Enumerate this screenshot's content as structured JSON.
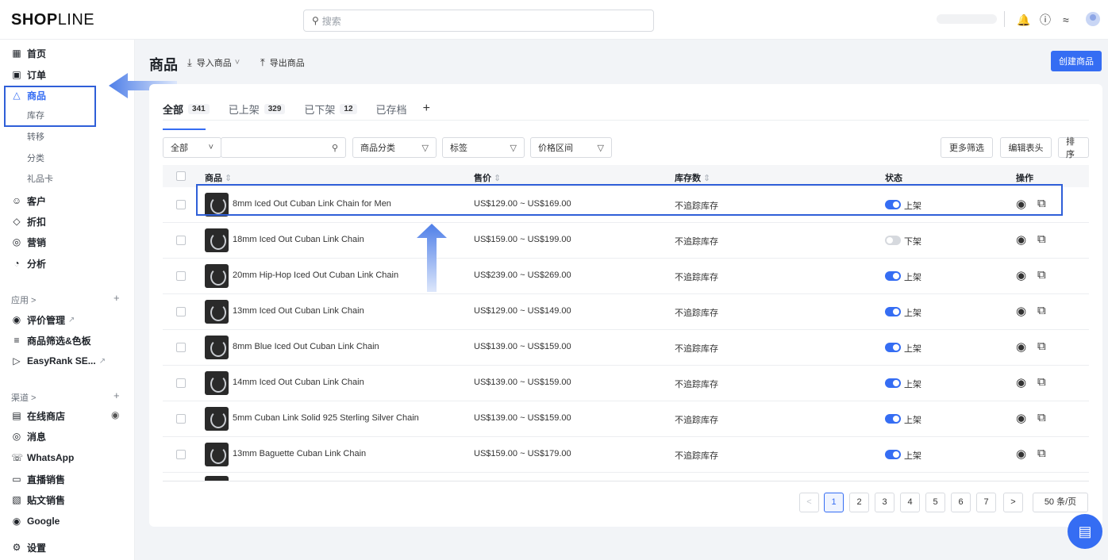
{
  "header": {
    "logo_bold": "SHOP",
    "logo_thin": "LINE",
    "search_placeholder": "搜索",
    "icons": [
      "bell-icon",
      "help-icon",
      "wifi-icon",
      "avatar"
    ]
  },
  "sidebar": {
    "items": [
      {
        "label": "首页",
        "icon": "dashboard-icon"
      },
      {
        "label": "订单",
        "icon": "order-icon"
      },
      {
        "label": "商品",
        "icon": "bag-icon",
        "active": true
      },
      {
        "label": "库存"
      },
      {
        "label": "转移"
      },
      {
        "label": "分类"
      },
      {
        "label": "礼品卡"
      },
      {
        "label": "客户",
        "icon": "user-icon"
      },
      {
        "label": "折扣",
        "icon": "tag-icon"
      },
      {
        "label": "营销",
        "icon": "target-icon"
      },
      {
        "label": "分析",
        "icon": "chart-icon"
      }
    ],
    "apps_section": "应用 >",
    "apps": [
      {
        "label": "评价管理",
        "icon": "review-icon"
      },
      {
        "label": "商品筛选&色板",
        "icon": "filter-icon"
      },
      {
        "label": "EasyRank SE...",
        "icon": "seo-icon"
      }
    ],
    "channels_section": "渠道 >",
    "channels": [
      {
        "label": "在线商店",
        "icon": "store-icon"
      },
      {
        "label": "消息",
        "icon": "message-icon"
      },
      {
        "label": "WhatsApp",
        "icon": "whatsapp-icon"
      },
      {
        "label": "直播销售",
        "icon": "live-icon"
      },
      {
        "label": "贴文销售",
        "icon": "post-icon"
      },
      {
        "label": "Google",
        "icon": "google-icon"
      }
    ],
    "settings": "设置"
  },
  "main": {
    "title": "商品",
    "import_label": "导入商品",
    "export_label": "导出商品",
    "create_label": "创建商品",
    "tabs": [
      {
        "label": "全部",
        "count": "341"
      },
      {
        "label": "已上架",
        "count": "329"
      },
      {
        "label": "已下架",
        "count": "12"
      },
      {
        "label": "已存档",
        "count": ""
      }
    ],
    "tab_add": "+",
    "filters": {
      "scope": "全部",
      "category": "商品分类",
      "tags": "标签",
      "price": "价格区间",
      "more": "更多筛选",
      "edit_columns": "编辑表头",
      "sort": "排序"
    },
    "columns": {
      "product": "商品",
      "price": "售价",
      "stock": "库存数",
      "status": "状态",
      "actions": "操作"
    },
    "rows": [
      {
        "name": "8mm Iced Out Cuban Link Chain for Men",
        "price": "US$129.00 ~ US$169.00",
        "stock": "不追踪库存",
        "status": "上架",
        "on": true
      },
      {
        "name": "18mm Iced Out Cuban Link Chain",
        "price": "US$159.00 ~ US$199.00",
        "stock": "不追踪库存",
        "status": "下架",
        "on": false
      },
      {
        "name": "20mm Hip-Hop Iced Out Cuban Link Chain",
        "price": "US$239.00 ~ US$269.00",
        "stock": "不追踪库存",
        "status": "上架",
        "on": true
      },
      {
        "name": "13mm Iced Out Cuban Link Chain",
        "price": "US$129.00 ~ US$149.00",
        "stock": "不追踪库存",
        "status": "上架",
        "on": true
      },
      {
        "name": "8mm Blue Iced Out Cuban Link Chain",
        "price": "US$139.00 ~ US$159.00",
        "stock": "不追踪库存",
        "status": "上架",
        "on": true
      },
      {
        "name": "14mm Iced Out Cuban Link Chain",
        "price": "US$139.00 ~ US$159.00",
        "stock": "不追踪库存",
        "status": "上架",
        "on": true
      },
      {
        "name": "5mm Cuban Link Solid 925 Sterling Silver Chain",
        "price": "US$139.00 ~ US$159.00",
        "stock": "不追踪库存",
        "status": "上架",
        "on": true
      },
      {
        "name": "13mm Baguette Cuban Link Chain",
        "price": "US$159.00 ~ US$179.00",
        "stock": "不追踪库存",
        "status": "上架",
        "on": true
      }
    ],
    "pagination": {
      "prev": "<",
      "pages": [
        "1",
        "2",
        "3",
        "4",
        "5",
        "6",
        "7"
      ],
      "current": "1",
      "next": ">",
      "page_size": "50 条/页"
    }
  },
  "colors": {
    "accent": "#356df3",
    "annotation": "#2f5fd8"
  }
}
